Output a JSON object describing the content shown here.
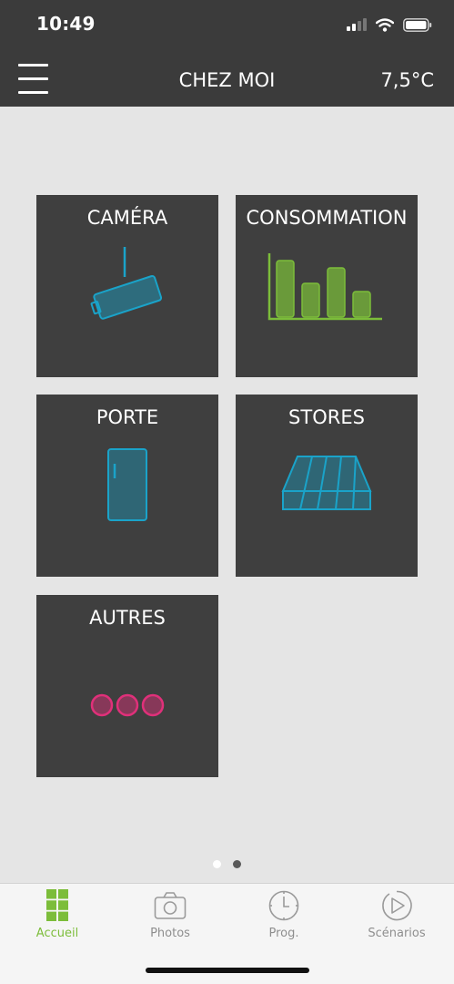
{
  "status_bar": {
    "time": "10:49"
  },
  "header": {
    "title": "CHEZ MOI",
    "temperature": "7,5°C",
    "menu_icon": "hamburger-menu-icon"
  },
  "tiles": [
    {
      "label": "CAMÉRA",
      "icon": "camera-icon"
    },
    {
      "label": "CONSOMMATION",
      "icon": "bar-chart-icon"
    },
    {
      "label": "PORTE",
      "icon": "door-icon"
    },
    {
      "label": "STORES",
      "icon": "awning-icon"
    },
    {
      "label": "AUTRES",
      "icon": "more-dots-icon"
    }
  ],
  "pager": {
    "pages": 2,
    "current": 2
  },
  "tabs": [
    {
      "label": "Accueil",
      "icon": "grid-home-icon",
      "active": true
    },
    {
      "label": "Photos",
      "icon": "photo-camera-icon",
      "active": false
    },
    {
      "label": "Prog.",
      "icon": "clock-icon",
      "active": false
    },
    {
      "label": "Scénarios",
      "icon": "play-icon",
      "active": false
    }
  ],
  "colors": {
    "header_bg": "#3b3b3b",
    "tile_bg": "#3f3f3f",
    "page_bg": "#e5e5e5",
    "camera_blue": "#1aa3c9",
    "chart_green": "#7cbd3a",
    "others_pink": "#e0307a",
    "active_tab": "#7cbd3a",
    "inactive_tab": "#8e8e8e"
  }
}
